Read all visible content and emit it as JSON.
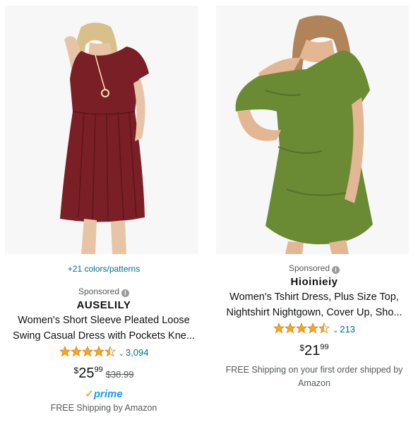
{
  "products": [
    {
      "colors_link": "+21 colors/patterns",
      "sponsored": "Sponsored",
      "brand": "AUSELILY",
      "title_line1": "Women's Short Sleeve Pleated Loose",
      "title_line2": "Swing Casual Dress with Pockets Kne...",
      "rating": 4.5,
      "review_count": "3,094",
      "price_symbol": "$",
      "price_whole": "25",
      "price_fraction": "99",
      "list_price": "$38.99",
      "prime_label": "prime",
      "shipping": "FREE Shipping by Amazon",
      "dress_color": "#7a1f26"
    },
    {
      "sponsored": "Sponsored",
      "brand": "Hioinieiy",
      "title_line1": "Women's Tshirt Dress, Plus Size Top,",
      "title_line2": "Nightshirt Nightgown, Cover Up, Sho...",
      "rating": 4.5,
      "review_count": "213",
      "price_symbol": "$",
      "price_whole": "21",
      "price_fraction": "99",
      "shipping_line1": "FREE Shipping on your first order shipped by",
      "shipping_line2": "Amazon",
      "dress_color": "#6b8a34"
    }
  ],
  "colors": {
    "link": "#007185",
    "star": "#f5a623",
    "prime": "#1a98ff",
    "prime_check": "#f3a847"
  },
  "icons": {
    "info": "info-circle-icon",
    "star": "star-icon",
    "chevron": "chevron-down-icon",
    "prime_check": "prime-check-icon"
  }
}
